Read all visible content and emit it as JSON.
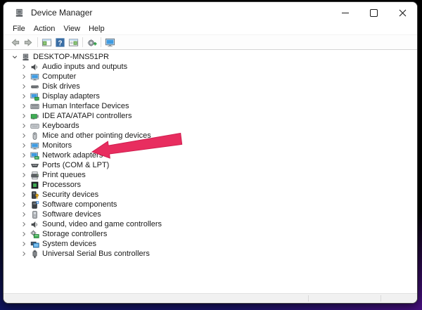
{
  "window": {
    "title": "Device Manager",
    "controls": [
      {
        "name": "minimize-button",
        "icon": "minimize-icon"
      },
      {
        "name": "maximize-button",
        "icon": "maximize-icon"
      },
      {
        "name": "close-button",
        "icon": "close-icon"
      }
    ]
  },
  "menu": {
    "items": [
      "File",
      "Action",
      "View",
      "Help"
    ]
  },
  "toolbar": {
    "items": [
      "back-icon",
      "forward-icon",
      "separator",
      "console-tree-icon",
      "help-icon",
      "action-pane-icon",
      "separator",
      "scan-hardware-icon",
      "separator",
      "computer-view-icon"
    ]
  },
  "tree": {
    "root": {
      "label": "DESKTOP-MNS51PR",
      "icon": "computer-root-icon",
      "expanded": true
    },
    "items": [
      {
        "label": "Audio inputs and outputs",
        "icon": "speaker-icon"
      },
      {
        "label": "Computer",
        "icon": "monitor-icon"
      },
      {
        "label": "Disk drives",
        "icon": "disk-drive-icon"
      },
      {
        "label": "Display adapters",
        "icon": "display-adapter-icon"
      },
      {
        "label": "Human Interface Devices",
        "icon": "hid-icon"
      },
      {
        "label": "IDE ATA/ATAPI controllers",
        "icon": "ide-controller-icon"
      },
      {
        "label": "Keyboards",
        "icon": "keyboard-icon"
      },
      {
        "label": "Mice and other pointing devices",
        "icon": "mouse-icon"
      },
      {
        "label": "Monitors",
        "icon": "monitor-icon"
      },
      {
        "label": "Network adapters",
        "icon": "network-adapter-icon"
      },
      {
        "label": "Ports (COM & LPT)",
        "icon": "port-icon"
      },
      {
        "label": "Print queues",
        "icon": "printer-icon"
      },
      {
        "label": "Processors",
        "icon": "cpu-icon"
      },
      {
        "label": "Security devices",
        "icon": "security-device-icon"
      },
      {
        "label": "Software components",
        "icon": "software-component-icon"
      },
      {
        "label": "Software devices",
        "icon": "software-device-icon"
      },
      {
        "label": "Sound, video and game controllers",
        "icon": "speaker-icon"
      },
      {
        "label": "Storage controllers",
        "icon": "storage-controller-icon"
      },
      {
        "label": "System devices",
        "icon": "system-device-icon"
      },
      {
        "label": "Universal Serial Bus controllers",
        "icon": "usb-icon"
      }
    ]
  },
  "annotation": {
    "type": "arrow",
    "color": "#e82d5f",
    "stroke": "#cf1e4f",
    "target": "Network adapters"
  },
  "statusbar": {
    "panes": [
      "",
      "",
      ""
    ]
  }
}
